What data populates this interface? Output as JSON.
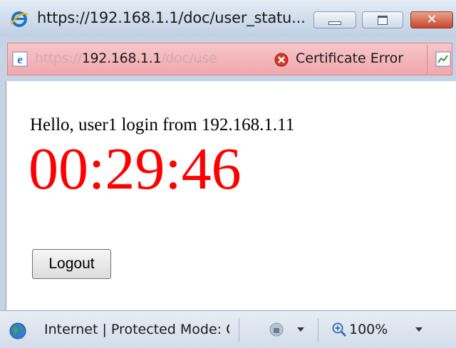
{
  "window": {
    "title": "https://192.168.1.1/doc/user_statu...",
    "minimize_icon": "minimize-icon",
    "maximize_icon": "maximize-icon",
    "close_icon": "close-icon"
  },
  "address_bar": {
    "url_scheme": "https://",
    "url_host": "192.168.1.1",
    "url_path": "/doc/use",
    "cert_error_label": "Certificate Error",
    "icons": [
      "ie-page-icon",
      "certificate-error-icon",
      "rss-feed-icon"
    ],
    "background_color": "#f0a8ad"
  },
  "page": {
    "greeting": "Hello, user1  login from 192.168.1.11",
    "timer": "00:29:46",
    "timer_color": "#ff0000",
    "logout_label": "Logout"
  },
  "status_bar": {
    "zone_text": "Internet | Protected Mode: On",
    "zoom_label": "100%"
  }
}
